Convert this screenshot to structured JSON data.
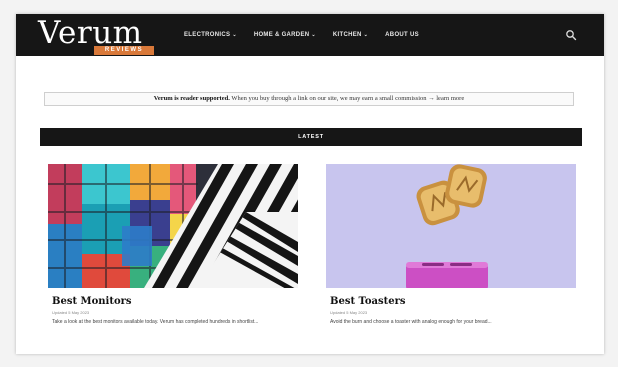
{
  "brand": {
    "name": "Verum",
    "tagline": "REVIEWS"
  },
  "nav": {
    "items": [
      {
        "label": "ELECTRONICS",
        "has_dropdown": true
      },
      {
        "label": "HOME & GARDEN",
        "has_dropdown": true
      },
      {
        "label": "KITCHEN",
        "has_dropdown": true
      },
      {
        "label": "ABOUT US",
        "has_dropdown": false
      }
    ],
    "dropdown_glyph": "⌄",
    "search_icon": "search-icon"
  },
  "disclaimer": {
    "bold": "Verum is reader supported.",
    "text": " When you buy through a link on our site, we may earn a small commission → ",
    "link": "learn more"
  },
  "section": {
    "title": "LATEST"
  },
  "articles": [
    {
      "title": "Best Monitors",
      "meta": "Updated 5 May 2023",
      "excerpt": "Take a look at the best monitors available today. Verum has completed hundreds in shortlist..."
    },
    {
      "title": "Best Toasters",
      "meta": "Updated 5 May 2023",
      "excerpt": "Avoid the burn and choose a toaster with analog enough for your bread..."
    }
  ],
  "colors": {
    "navbar": "#161616",
    "accent": "#d9793a",
    "section_bar": "#161616",
    "toaster_bg": "#c8c5ee",
    "toaster_body": "#cc4fc4"
  }
}
